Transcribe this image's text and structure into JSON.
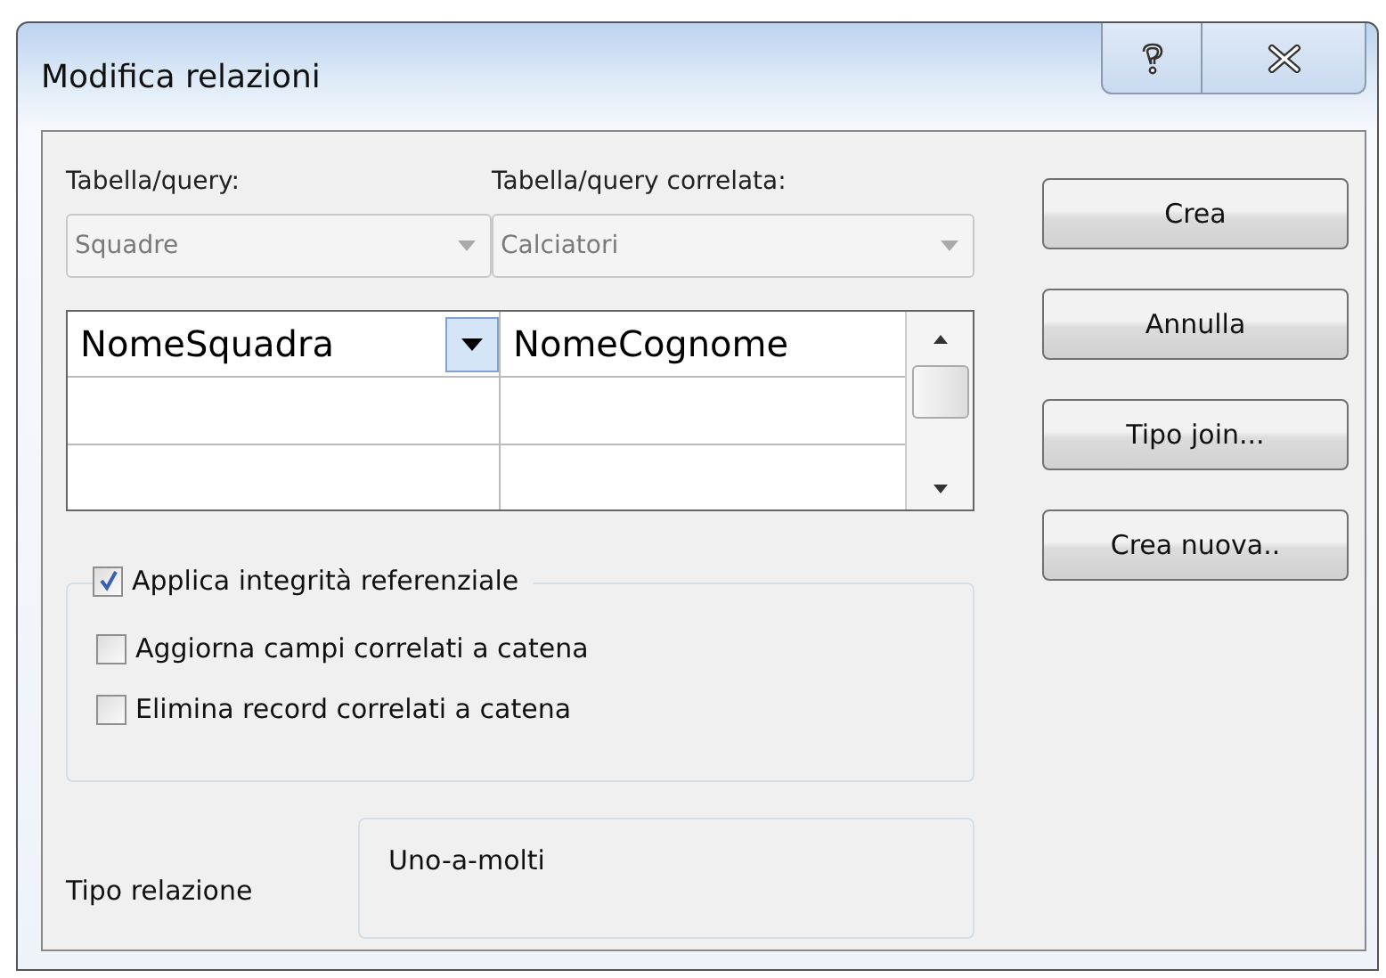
{
  "window": {
    "title": "Modifica relazioni"
  },
  "tables": [
    {
      "label": "Tabella/query:",
      "value": "Squadre",
      "disabled": true
    },
    {
      "label": "Tabella/query correlata:",
      "value": "Calciatori",
      "disabled": true
    }
  ],
  "fields": [
    {
      "left": "NomeSquadra",
      "right": "NomeCognome",
      "dropdown": true
    }
  ],
  "options": [
    {
      "label": "Applica integrità referenziale",
      "checked": true
    },
    {
      "label": "Aggiorna campi correlati a catena",
      "checked": false
    },
    {
      "label": "Elimina record correlati a catena",
      "checked": false
    }
  ],
  "relation": {
    "label": "Tipo relazione",
    "value": "Uno-a-molti"
  },
  "buttons": [
    "Crea",
    "Annulla",
    "Tipo join...",
    "Crea nuova.."
  ]
}
